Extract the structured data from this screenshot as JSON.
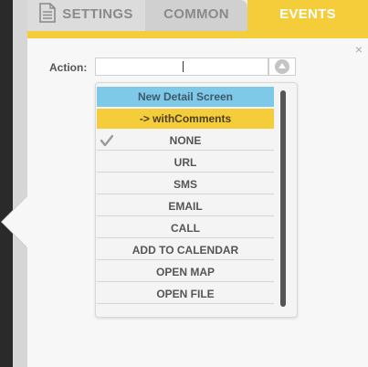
{
  "tabs": [
    {
      "label": "SETTINGS",
      "icon": "document-icon"
    },
    {
      "label": "COMMON"
    },
    {
      "label": "EVENTS",
      "active": true
    }
  ],
  "panel": {
    "close_label": "×",
    "action_label": "Action:",
    "action_value": ""
  },
  "dropdown": {
    "options": [
      {
        "label": "New Detail Screen"
      },
      {
        "label": "-> withComments"
      },
      {
        "label": "NONE",
        "selected": true
      },
      {
        "label": "URL"
      },
      {
        "label": "SMS"
      },
      {
        "label": "EMAIL"
      },
      {
        "label": "CALL"
      },
      {
        "label": "ADD TO CALENDAR"
      },
      {
        "label": "OPEN MAP"
      },
      {
        "label": "OPEN FILE"
      }
    ]
  },
  "colors": {
    "accent_yellow": "#f5cc3a",
    "header_blue": "#7ec8e8"
  }
}
